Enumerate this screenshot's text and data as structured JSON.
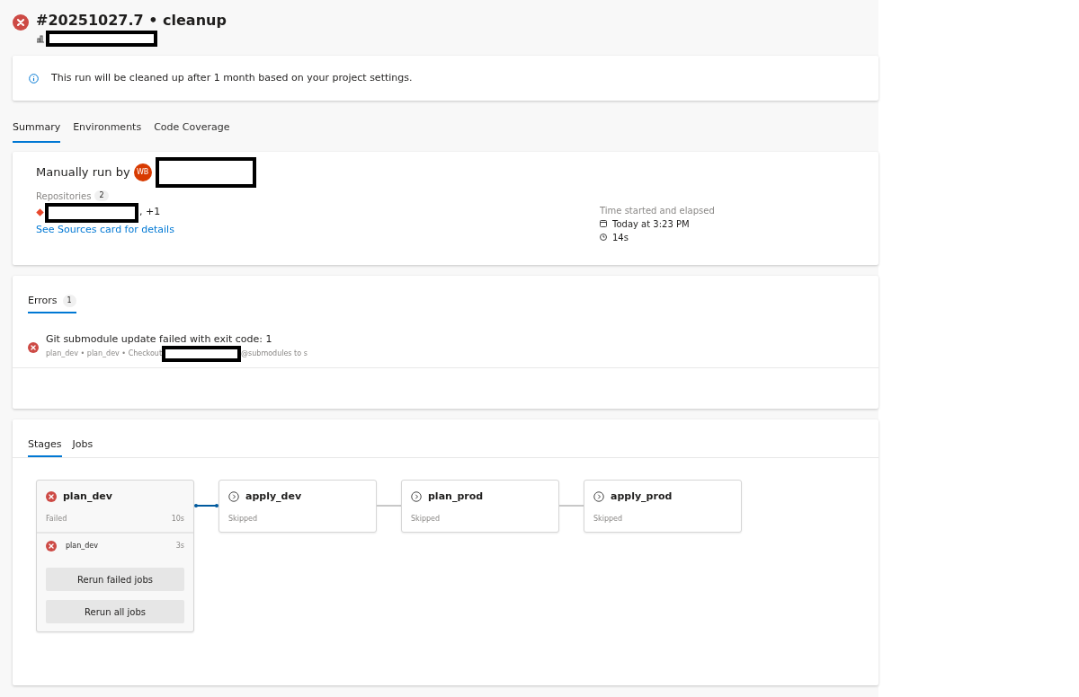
{
  "header": {
    "failed": true,
    "title": "#20251027.7 • cleanup"
  },
  "notice": {
    "text": "This run will be cleaned up after 1 month based on your project settings."
  },
  "tabs": [
    {
      "label": "Summary",
      "selected": true
    },
    {
      "label": "Environments",
      "selected": false
    },
    {
      "label": "Code Coverage",
      "selected": false
    }
  ],
  "summary": {
    "run_by_label": "Manually run by",
    "avatar_initials": "WB",
    "repositories_label": "Repositories",
    "repositories_count": "2",
    "repositories_more": ", +1",
    "sources_link": "See Sources card for details",
    "time_label": "Time started and elapsed",
    "started": "Today at 3:23 PM",
    "elapsed": "14s"
  },
  "errors": {
    "tab": {
      "label": "Errors",
      "count": "1",
      "selected": true
    },
    "items": [
      {
        "failed": true,
        "message": "Git submodule update failed with exit code: 1",
        "path_before": "plan_dev • plan_dev • Checkout",
        "path_after": "@submodules to s"
      }
    ]
  },
  "stage_tabs": [
    {
      "label": "Stages",
      "selected": true
    },
    {
      "label": "Jobs",
      "selected": false
    }
  ],
  "stages": [
    {
      "name": "plan_dev",
      "failed": true,
      "status_text": "Failed",
      "duration": "10s",
      "selected": true,
      "expanded": true,
      "jobs": [
        {
          "name": "plan_dev",
          "failed": true,
          "duration": "3s"
        }
      ],
      "actions": [
        "Rerun failed jobs",
        "Rerun all jobs"
      ]
    },
    {
      "name": "apply_dev",
      "failed": false,
      "status_text": "Skipped",
      "selected": false,
      "expanded": false
    },
    {
      "name": "plan_prod",
      "failed": false,
      "status_text": "Skipped",
      "selected": false,
      "expanded": false
    },
    {
      "name": "apply_prod",
      "failed": false,
      "status_text": "Skipped",
      "selected": false,
      "expanded": false
    }
  ]
}
